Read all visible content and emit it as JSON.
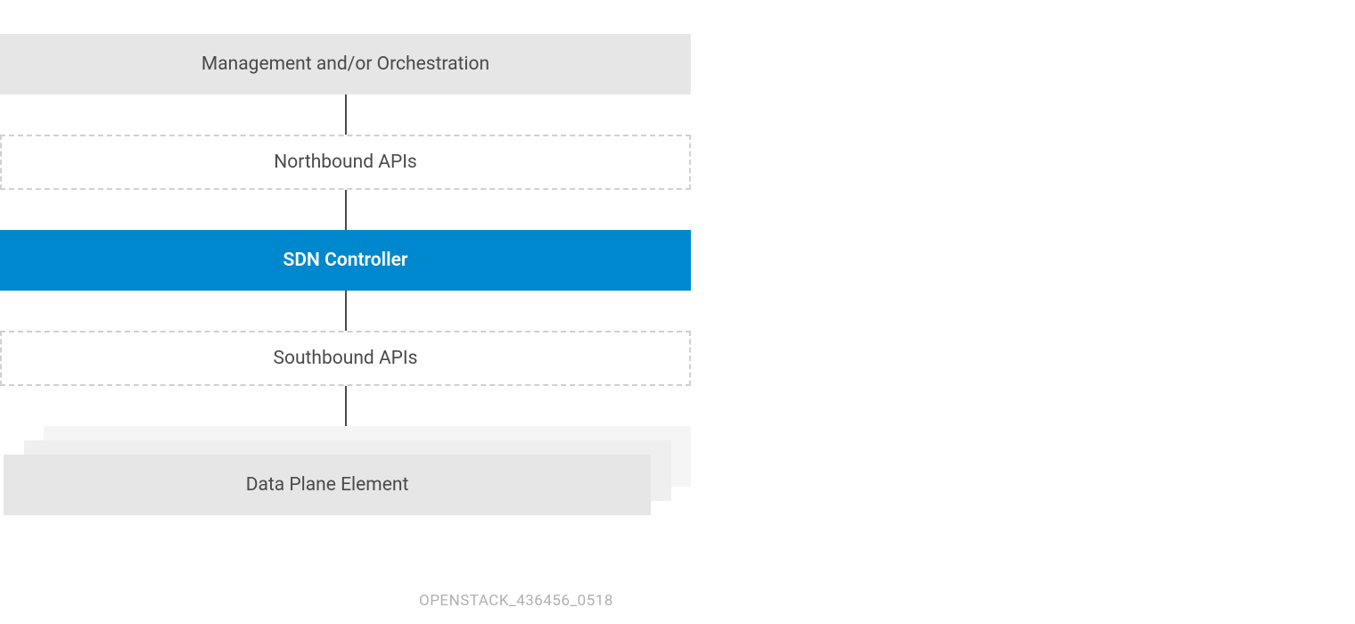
{
  "layers": {
    "management": "Management and/or Orchestration",
    "northbound": "Northbound APIs",
    "controller": "SDN Controller",
    "southbound": "Southbound APIs",
    "dataplane": "Data Plane Element"
  },
  "footer": "OPENSTACK_436456_0518"
}
